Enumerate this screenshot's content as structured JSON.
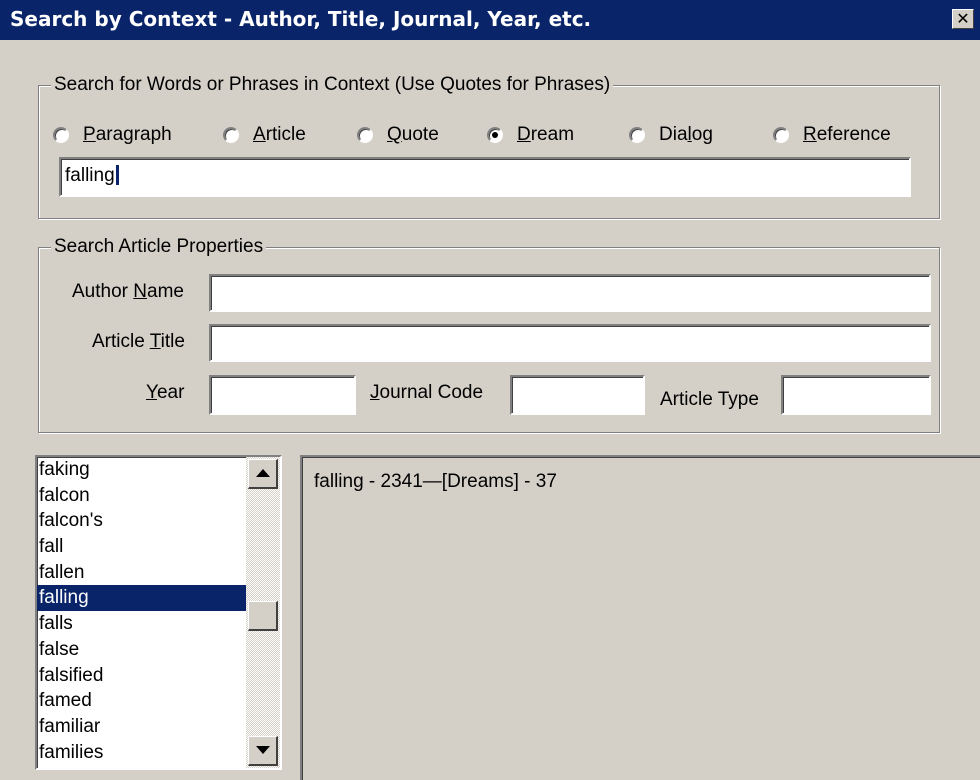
{
  "window": {
    "title": "Search by Context - Author, Title, Journal, Year, etc.",
    "close_glyph": "✕"
  },
  "context_group": {
    "legend": "Search for Words or Phrases in Context (Use Quotes for Phrases)",
    "options": [
      {
        "mnemonic": "P",
        "rest": "aragraph",
        "selected": false
      },
      {
        "mnemonic": "A",
        "rest": "rticle",
        "selected": false
      },
      {
        "mnemonic": "Q",
        "rest": "uote",
        "selected": false
      },
      {
        "mnemonic": "D",
        "rest": "ream",
        "selected": true
      },
      {
        "pre": "Dia",
        "mnemonic": "l",
        "rest": "og",
        "selected": false
      },
      {
        "mnemonic": "R",
        "rest": "eference",
        "selected": false
      }
    ],
    "search_value": "falling"
  },
  "properties_group": {
    "legend": "Search Article Properties",
    "author": {
      "pre": "Author ",
      "mnemonic": "N",
      "rest": "ame",
      "value": ""
    },
    "title": {
      "pre": "Article ",
      "mnemonic": "T",
      "rest": "itle",
      "value": ""
    },
    "year": {
      "mnemonic": "Y",
      "rest": "ear",
      "value": ""
    },
    "journal": {
      "mnemonic": "J",
      "rest": "ournal Code",
      "value": ""
    },
    "type": {
      "label": "Article Type",
      "value": ""
    }
  },
  "word_list": {
    "items": [
      "faking",
      "falcon",
      "falcon's",
      "fall",
      "fallen",
      "falling",
      "falls",
      "false",
      "falsified",
      "famed",
      "familiar",
      "families"
    ],
    "selected_index": 5
  },
  "results": {
    "lines": [
      "falling - 2341—[Dreams] - 37"
    ]
  },
  "colors": {
    "titlebar": "#0a246a",
    "face": "#d4d0c8",
    "selection": "#0a246a"
  },
  "icons": {
    "scroll_up": "scroll-up-icon",
    "scroll_down": "scroll-down-icon",
    "close": "close-icon"
  }
}
